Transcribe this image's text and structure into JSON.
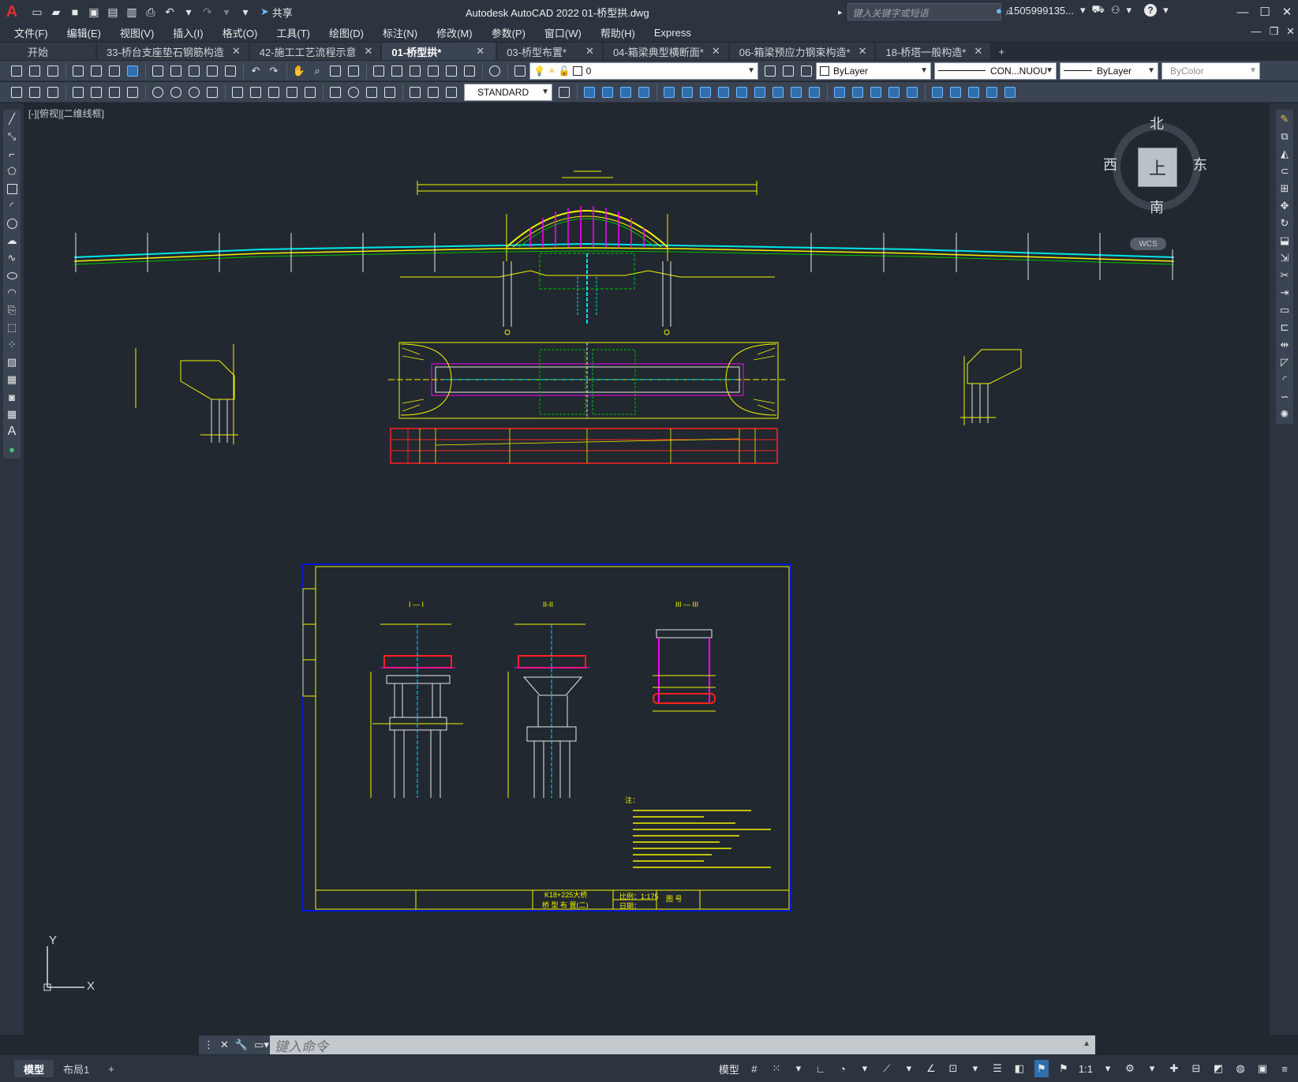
{
  "titlebar": {
    "logo": "A",
    "share_label": "共享",
    "title": "Autodesk AutoCAD 2022    01-桥型拱.dwg",
    "search_placeholder": "键入关键字或短语",
    "user": "1505999135...",
    "help": "?"
  },
  "menu": [
    "文件(F)",
    "编辑(E)",
    "视图(V)",
    "插入(I)",
    "格式(O)",
    "工具(T)",
    "绘图(D)",
    "标注(N)",
    "修改(M)",
    "参数(P)",
    "窗口(W)",
    "帮助(H)",
    "Express"
  ],
  "tabs": [
    {
      "label": "开始",
      "closable": false,
      "active": false
    },
    {
      "label": "33-桥台支座垫石钢筋构造",
      "closable": true,
      "active": false
    },
    {
      "label": "42-施工工艺流程示意",
      "closable": true,
      "active": false
    },
    {
      "label": "01-桥型拱*",
      "closable": true,
      "active": true
    },
    {
      "label": "03-桥型布置*",
      "closable": true,
      "active": false
    },
    {
      "label": "04-箱梁典型横断面*",
      "closable": true,
      "active": false
    },
    {
      "label": "06-箱梁预应力钢束构造*",
      "closable": true,
      "active": false
    },
    {
      "label": "18-桥塔一般构造*",
      "closable": true,
      "active": false
    }
  ],
  "toolbar": {
    "layer_value": "0",
    "color_value": "ByLayer",
    "linetype_value": "CON...NUOU",
    "lineweight_value": "ByLayer",
    "plotstyle_value": "ByColor",
    "textstyle_value": "STANDARD"
  },
  "viewport": {
    "label": "[-][俯视][二维线框]"
  },
  "viewcube": {
    "top_face": "上",
    "north": "北",
    "south": "南",
    "east": "东",
    "west": "西",
    "wcs": "WCS"
  },
  "drawing": {
    "section_1": "I — I",
    "section_2": "II-II",
    "section_3": "III — III",
    "notes_title": "注：",
    "stake": "K18+225大桥",
    "sheet_name": "桥 型 布 置(二)",
    "scale_label": "比例：",
    "scale_value": "1:175",
    "date_label": "日期：",
    "drawing_no_label": "图 号"
  },
  "ucs": {
    "x": "X",
    "y": "Y"
  },
  "command": {
    "placeholder": "键入命令"
  },
  "status": {
    "layout_tabs": [
      {
        "label": "模型",
        "active": true
      },
      {
        "label": "布局1",
        "active": false
      }
    ],
    "model_label": "模型",
    "scale": "1:1"
  },
  "colors": {
    "accent": "#2f6fae",
    "cad_yellow": "#f4f400",
    "cad_cyan": "#00e5e5",
    "cad_magenta": "#ff00ff",
    "cad_red": "#ff2020",
    "cad_green": "#00c000",
    "cad_blue": "#0018d8"
  }
}
